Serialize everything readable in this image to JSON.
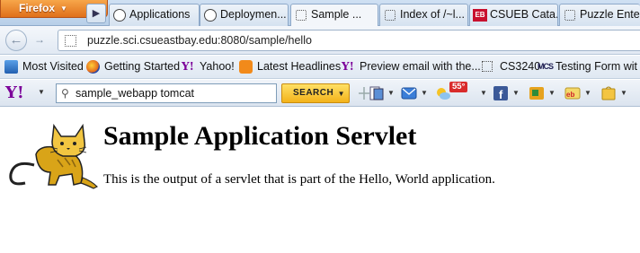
{
  "browser": {
    "menu_label": "Firefox",
    "tabs": [
      {
        "label": "Applications",
        "icon": "tomcat-icon",
        "active": false
      },
      {
        "label": "Deploymen...",
        "icon": "tomcat-icon",
        "active": false
      },
      {
        "label": "Sample ...",
        "icon": "blank-page-icon",
        "active": true
      },
      {
        "label": "Index of /~l...",
        "icon": "blank-page-icon",
        "active": false
      },
      {
        "label": "CSUEB Cata...",
        "icon": "eb-icon",
        "active": false
      },
      {
        "label": "Puzzle Enter...",
        "icon": "blank-page-icon",
        "active": false
      }
    ],
    "url": "puzzle.sci.csueastbay.edu:8080/sample/hello"
  },
  "bookmarks": [
    {
      "label": "Most Visited",
      "icon": "bookmarks-icon"
    },
    {
      "label": "Getting Started",
      "icon": "firefox-icon"
    },
    {
      "label": "Yahoo!",
      "icon": "yahoo-icon"
    },
    {
      "label": "Latest Headlines",
      "icon": "rss-icon"
    },
    {
      "label": "Preview email with the...",
      "icon": "yahoo-icon"
    },
    {
      "label": "CS3240",
      "icon": "blank-page-icon"
    },
    {
      "label": "Testing Form wit",
      "icon": "mcs-icon"
    }
  ],
  "yahoo_toolbar": {
    "logo": "Y!",
    "search_value": "sample_webapp tomcat",
    "search_button": "SEARCH",
    "weather_temp": "55°"
  },
  "page": {
    "title": "Sample Application Servlet",
    "body": "This is the output of a servlet that is part of the Hello, World application."
  },
  "colors": {
    "firefox_orange": "#e0701a",
    "yahoo_purple": "#7b0099",
    "search_button_yellow": "#f3b31a"
  }
}
